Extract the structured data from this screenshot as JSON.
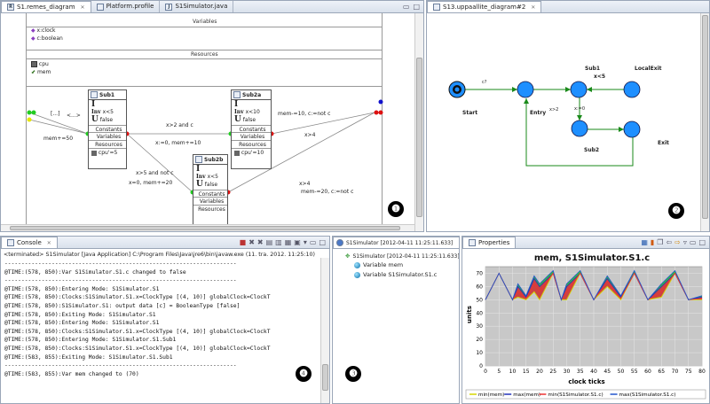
{
  "pane1": {
    "tabs": [
      {
        "label": "S1.remes_diagram",
        "icon": "R",
        "active": true
      },
      {
        "label": "Platform.profile",
        "icon": "",
        "active": false
      },
      {
        "label": "S1Simulator.java",
        "icon": "J",
        "active": false
      }
    ],
    "variables_header": "Variables",
    "variables": [
      "x:clock",
      "c:boolean"
    ],
    "resources_header": "Resources",
    "resources": [
      "cpu",
      "mem"
    ],
    "initial_labels": {
      "dots": "[...]",
      "arrow": "<...>",
      "assign": "mem+=50"
    },
    "sub1": {
      "name": "Sub1",
      "i": "I",
      "inv": "Inv",
      "inv_expr": "x<5",
      "u": "U",
      "u_val": "false",
      "constants": "Constants",
      "variables": "Variables",
      "resources": "Resources",
      "res_expr": "cpu'=5"
    },
    "sub2a": {
      "name": "Sub2a",
      "i": "I",
      "inv": "Inv",
      "inv_expr": "x<10",
      "u": "U",
      "u_val": "false",
      "constants": "Constants",
      "variables": "Variables",
      "resources": "Resources",
      "res_expr": "cpu'=10"
    },
    "sub2b": {
      "name": "Sub2b",
      "i": "I",
      "inv": "Inv",
      "inv_expr": "x<5",
      "u": "U",
      "u_val": "false",
      "constants": "Constants",
      "variables": "Variables",
      "resources": "Resources"
    },
    "edges": {
      "e1": "x>2 and c",
      "e2": "x:=0, mem+=10",
      "e3": "x>5 and not c",
      "e4": "x=0, mem+=20",
      "e5": "mem-=10, c:=not c",
      "e6": "x>4",
      "e7": "x>4",
      "e8": "mem-=20, c:=not c"
    },
    "badge": "❶"
  },
  "pane2": {
    "tab": "S13.uppaallite_diagram#2",
    "states": {
      "start": "Start",
      "entry": "Entry",
      "sub1": "Sub1",
      "localexit": "LocalExit",
      "sub2": "Sub2",
      "exit": "Exit"
    },
    "labels": {
      "c": "c?",
      "x2": "x>2",
      "x0": "x:=0",
      "inv": "x<5"
    },
    "badge": "❷"
  },
  "console": {
    "tab": "Console",
    "terminated": "<terminated> S1Simulator [Java Application] C:\\Program Files\\Java\\jre6\\bin\\javaw.exe (11. tra. 2012. 11:25:10)",
    "lines": [
      "---------------------------------------------------------------------",
      "@TIME:(578, 850):Var S1Simulator.S1.c changed to false",
      "---------------------------------------------------------------------",
      "@TIME:(578, 850):Entering Mode: S1Simulator.S1",
      "@TIME:(578, 850):Clocks:S1Simulator.S1.x=ClockType [(4, 10)] globalClock=ClockT",
      "@TIME:(578, 850):S1Simulator.S1: output data [c] = BooleanType [false]",
      "@TIME:(578, 850):Exiting Mode: S1Simulator.S1",
      "@TIME:(578, 850):Entering Mode: S1Simulator.S1",
      "@TIME:(578, 850):Clocks:S1Simulator.S1.x=ClockType [(4, 10)] globalClock=ClockT",
      "@TIME:(578, 850):Entering Mode: S1Simulator.S1.Sub1",
      "@TIME:(578, 850):Clocks:S1Simulator.S1.x=ClockType [(4, 10)] globalClock=ClockT",
      "@TIME:(583, 855):Exiting Mode: S1Simulator.S1.Sub1",
      "---------------------------------------------------------------------",
      "@TIME:(583, 855):Var mem changed to (70)"
    ],
    "badge": "❹"
  },
  "simulator": {
    "tab": "S1Simulator [2012-04-11 11:25:11.633]",
    "root": "S1Simulator [2012-04-11 11:25:11.633]",
    "items": [
      "Variable mem",
      "Variable S1Simulator.S1.c"
    ],
    "properties_tab": "Properties",
    "badge": "❸"
  },
  "chart_data": {
    "type": "area",
    "title": "mem, S1Simulator.S1.c",
    "xlabel": "clock ticks",
    "ylabel": "units",
    "xlim": [
      0,
      80
    ],
    "ylim": [
      0,
      75
    ],
    "xticks": [
      0,
      5,
      10,
      15,
      20,
      25,
      30,
      35,
      40,
      45,
      50,
      55,
      60,
      65,
      70,
      75,
      80
    ],
    "yticks": [
      0,
      10,
      20,
      30,
      40,
      50,
      60,
      70
    ],
    "x": [
      0,
      5,
      10,
      12,
      15,
      18,
      20,
      25,
      28,
      30,
      35,
      40,
      45,
      50,
      55,
      60,
      65,
      70,
      75,
      80
    ],
    "series": [
      {
        "name": "min(mem)",
        "color": "#d6d600",
        "values": [
          50,
          70,
          50,
          52,
          50,
          56,
          50,
          70,
          50,
          50,
          70,
          50,
          60,
          50,
          70,
          50,
          52,
          70,
          50,
          50
        ]
      },
      {
        "name": "max(mem)",
        "color": "#2233bb",
        "values": [
          50,
          70,
          50,
          60,
          52,
          66,
          60,
          70,
          50,
          60,
          70,
          50,
          66,
          52,
          70,
          50,
          60,
          70,
          50,
          52
        ]
      },
      {
        "name": "min(S1Simulator.S1.c)",
        "color": "#ee3333",
        "values": [
          50,
          70,
          50,
          56,
          51,
          62,
          56,
          70,
          50,
          56,
          70,
          50,
          64,
          51,
          70,
          50,
          56,
          70,
          50,
          51
        ]
      },
      {
        "name": "max(S1Simulator.S1.c)",
        "color": "#2255cc",
        "values": [
          50,
          70,
          50,
          62,
          53,
          68,
          62,
          72,
          50,
          62,
          72,
          50,
          68,
          53,
          72,
          50,
          62,
          72,
          50,
          53
        ]
      }
    ],
    "fill_colors": {
      "mem_band": "#22cc22",
      "c_band": "#dd3344"
    },
    "legend_position": "bottom",
    "grid": true
  }
}
